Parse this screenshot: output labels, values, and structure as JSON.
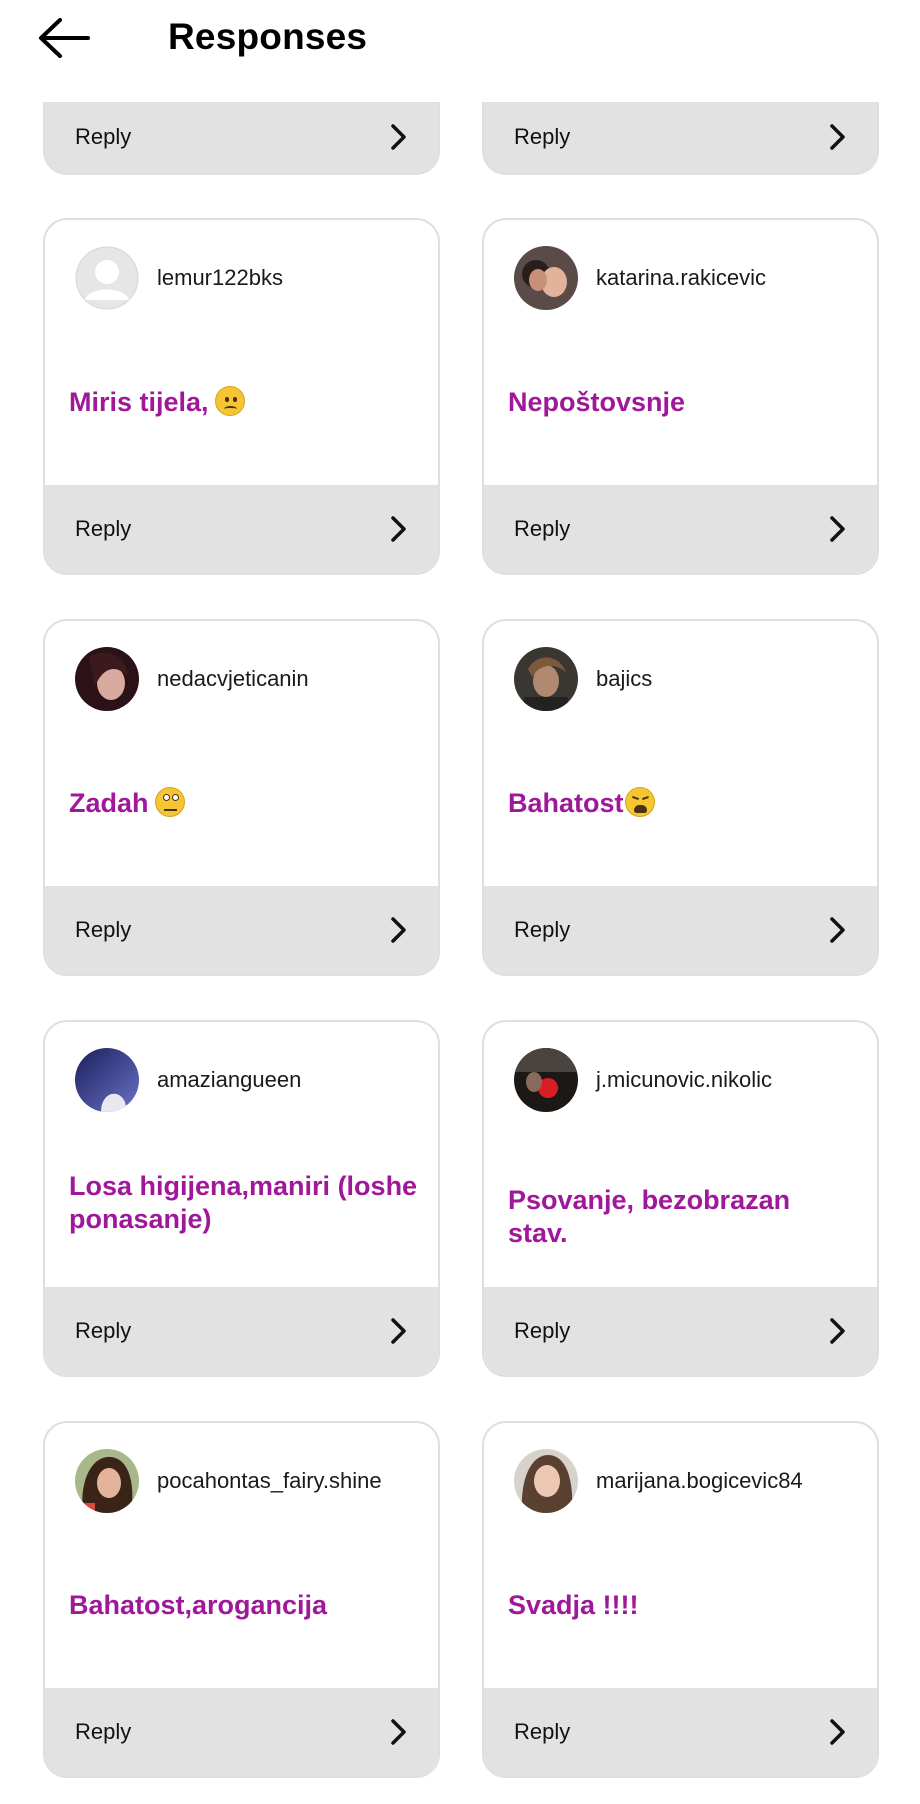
{
  "header": {
    "title": "Responses"
  },
  "reply_label": "Reply",
  "cards": [
    {
      "username": "lemur122bks",
      "message": "Miris tijela,",
      "emoji": "frowning-face-emoji",
      "avatar": "default-avatar"
    },
    {
      "username": "katarina.rakicevic",
      "message": "Nepoštovsnje",
      "avatar": "photo"
    },
    {
      "username": "nedacvjeticanin",
      "message": "Zadah",
      "emoji": "eye-roll-emoji",
      "avatar": "photo"
    },
    {
      "username": "bajics",
      "message": "Bahatost",
      "emoji": "tired-face-emoji",
      "avatar": "photo"
    },
    {
      "username": "amaziangueen",
      "message": "Losa higijena,maniri (loshe ponasanje)",
      "avatar": "photo"
    },
    {
      "username": "j.micunovic.nikolic",
      "message": "Psovanje, bezobrazan stav.",
      "avatar": "photo"
    },
    {
      "username": "pocahontas_fairy.shine",
      "message": "Bahatost,arogancija",
      "avatar": "photo"
    },
    {
      "username": "marijana.bogicevic84",
      "message": "Svadja !!!!",
      "avatar": "photo"
    }
  ],
  "colors": {
    "message": "#a0189a",
    "reply_bar": "#e2e2e2",
    "card_border": "#dfdfdf"
  }
}
